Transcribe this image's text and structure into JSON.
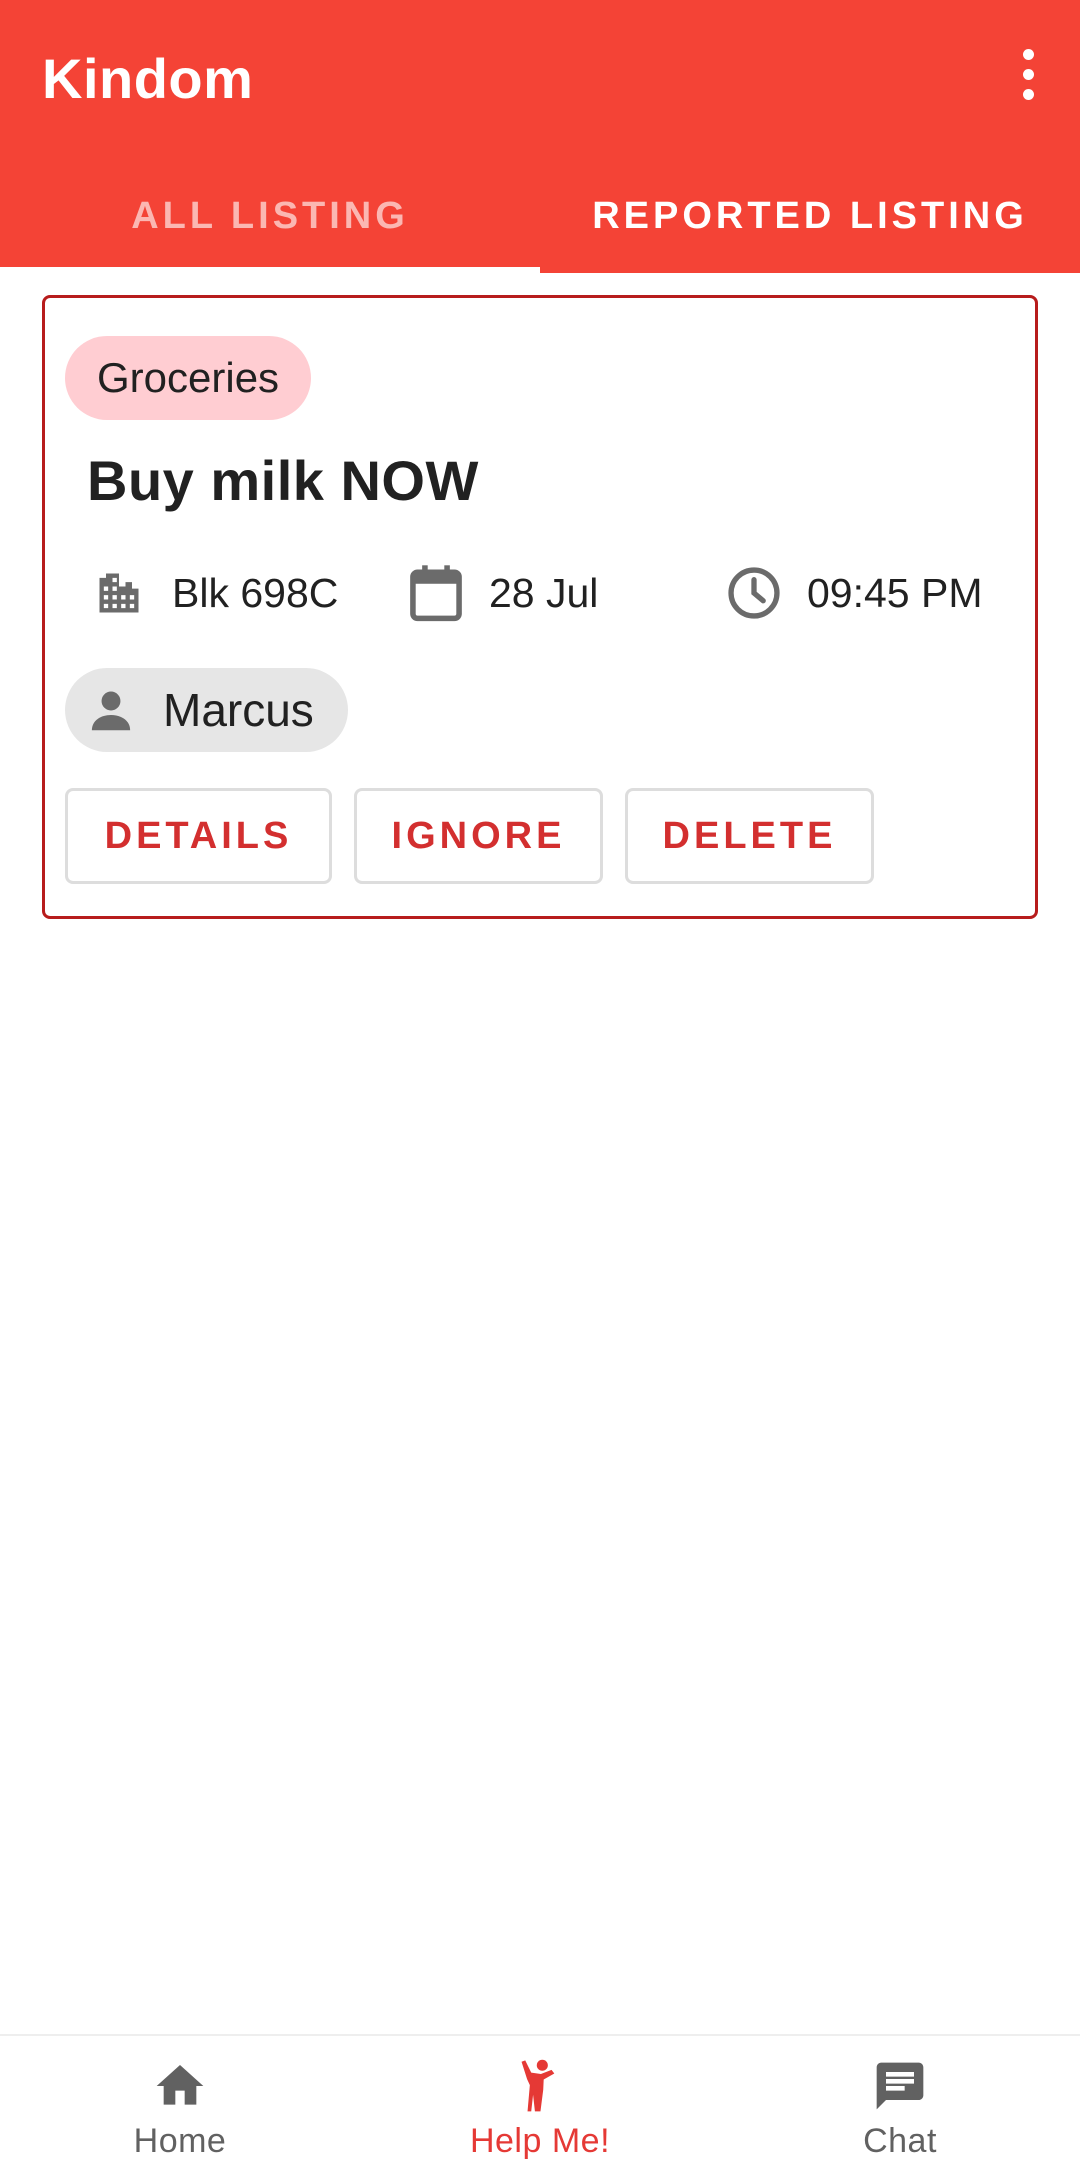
{
  "app": {
    "title": "Kindom",
    "colors": {
      "primary": "#F44336",
      "accent": "#D32F2F",
      "card_border": "#B71C1C",
      "category_chip": "#FFCDD2",
      "user_chip": "#E6E6E6"
    }
  },
  "header": {
    "menu_icon": "more-vert-icon",
    "tabs": [
      {
        "label": "ALL LISTING",
        "active": false
      },
      {
        "label": "REPORTED LISTING",
        "active": true
      }
    ]
  },
  "listing": {
    "category": "Groceries",
    "title": "Buy milk NOW",
    "location": {
      "icon": "building-icon",
      "text": "Blk 698C"
    },
    "date": {
      "icon": "calendar-icon",
      "text": "28 Jul"
    },
    "time": {
      "icon": "clock-icon",
      "text": "09:45 PM"
    },
    "user": {
      "icon": "person-icon",
      "name": "Marcus"
    },
    "actions": {
      "details": "DETAILS",
      "ignore": "IGNORE",
      "delete": "DELETE"
    }
  },
  "bottom_nav": {
    "items": [
      {
        "label": "Home",
        "icon": "home-icon",
        "active": false
      },
      {
        "label": "Help Me!",
        "icon": "waving-person-icon",
        "active": true
      },
      {
        "label": "Chat",
        "icon": "chat-icon",
        "active": false
      }
    ]
  }
}
